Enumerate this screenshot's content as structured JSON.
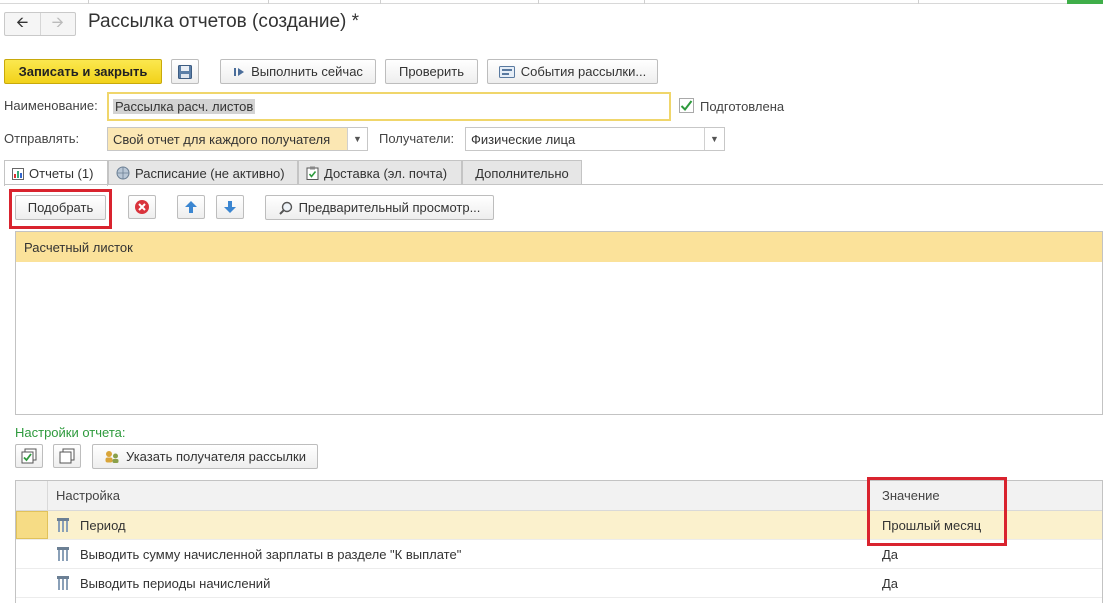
{
  "window": {
    "title": "Рассылка отчетов (создание) *"
  },
  "toolbar": {
    "save_close": "Записать и закрыть",
    "run_now": "Выполнить сейчас",
    "check": "Проверить",
    "events": "События рассылки..."
  },
  "form": {
    "name_label": "Наименование:",
    "name_value": "Рассылка расч. листов",
    "prepared_label": "Подготовлена",
    "prepared_checked": true,
    "send_label": "Отправлять:",
    "send_value": "Свой отчет для каждого получателя",
    "recipients_label": "Получатели:",
    "recipients_value": "Физические лица"
  },
  "tabs": [
    {
      "label": "Отчеты (1)",
      "icon": "report-icon",
      "active": true
    },
    {
      "label": "Расписание (не активно)",
      "icon": "globe-icon",
      "active": false
    },
    {
      "label": "Доставка (эл. почта)",
      "icon": "clipboard-icon",
      "active": false
    },
    {
      "label": "Дополнительно",
      "icon": "",
      "active": false
    }
  ],
  "reports": {
    "pick_button": "Подобрать",
    "preview_button": "Предварительный просмотр...",
    "items": [
      "Расчетный листок"
    ]
  },
  "settings": {
    "section_label": "Настройки отчета:",
    "set_recipient_button": "Указать получателя рассылки",
    "columns": {
      "setting": "Настройка",
      "value": "Значение"
    },
    "rows": [
      {
        "setting": "Период",
        "value": "Прошлый месяц"
      },
      {
        "setting": "Выводить сумму начисленной зарплаты в разделе \"К выплате\"",
        "value": "Да"
      },
      {
        "setting": "Выводить периоды начислений",
        "value": "Да"
      }
    ]
  },
  "colors": {
    "primary_button": "#f5d928",
    "selected_row": "#fbe29a",
    "highlight_border": "#d9232e",
    "section_label": "#2e9a3d"
  }
}
